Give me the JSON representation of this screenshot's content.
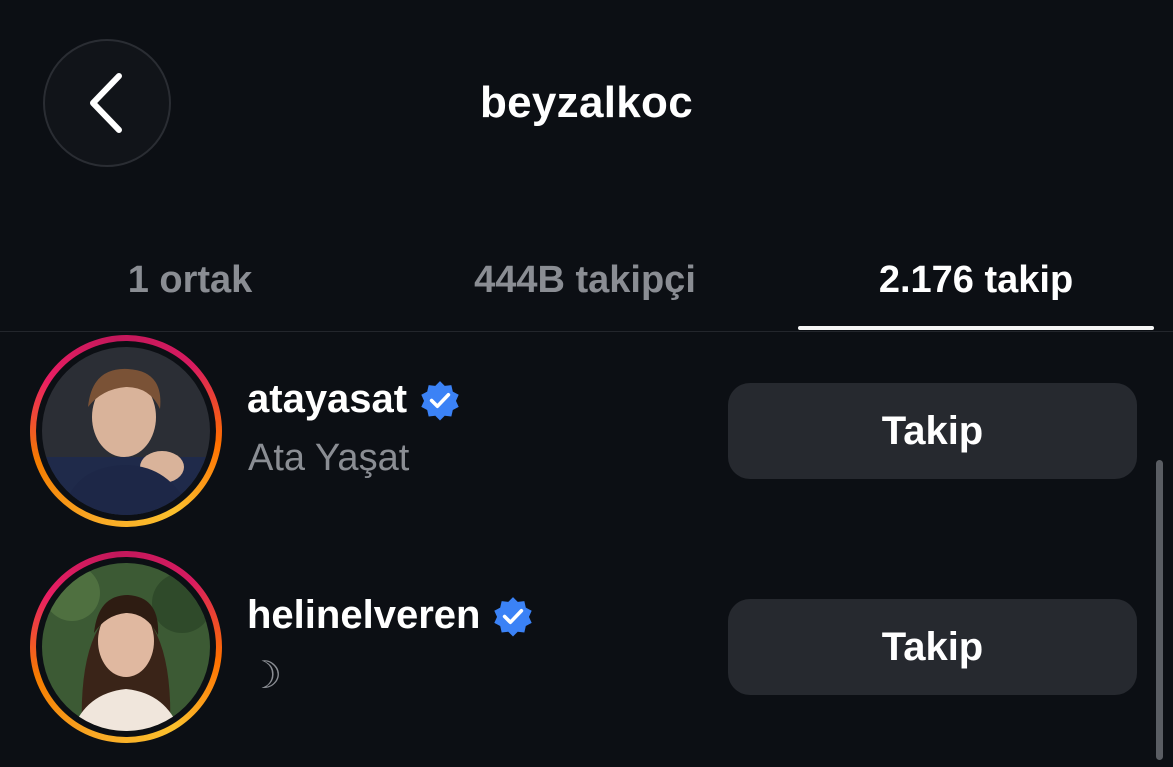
{
  "header": {
    "title": "beyzalkoc",
    "back_icon": "chevron-left-icon"
  },
  "tabs": [
    {
      "label": "1 ortak",
      "active": false
    },
    {
      "label": "444B takipçi",
      "active": false
    },
    {
      "label": "2.176 takip",
      "active": true
    }
  ],
  "users": [
    {
      "username": "atayasat",
      "verified": true,
      "subtitle": "Ata Yaşat",
      "button_label": "Takip"
    },
    {
      "username": "helinelveren",
      "verified": true,
      "subtitle": "☽",
      "button_label": "Takip"
    }
  ],
  "colors": {
    "background": "#0c0f14",
    "button_bg": "#26292f",
    "verified_blue": "#3b82f6",
    "muted_text": "#8a8d93"
  }
}
